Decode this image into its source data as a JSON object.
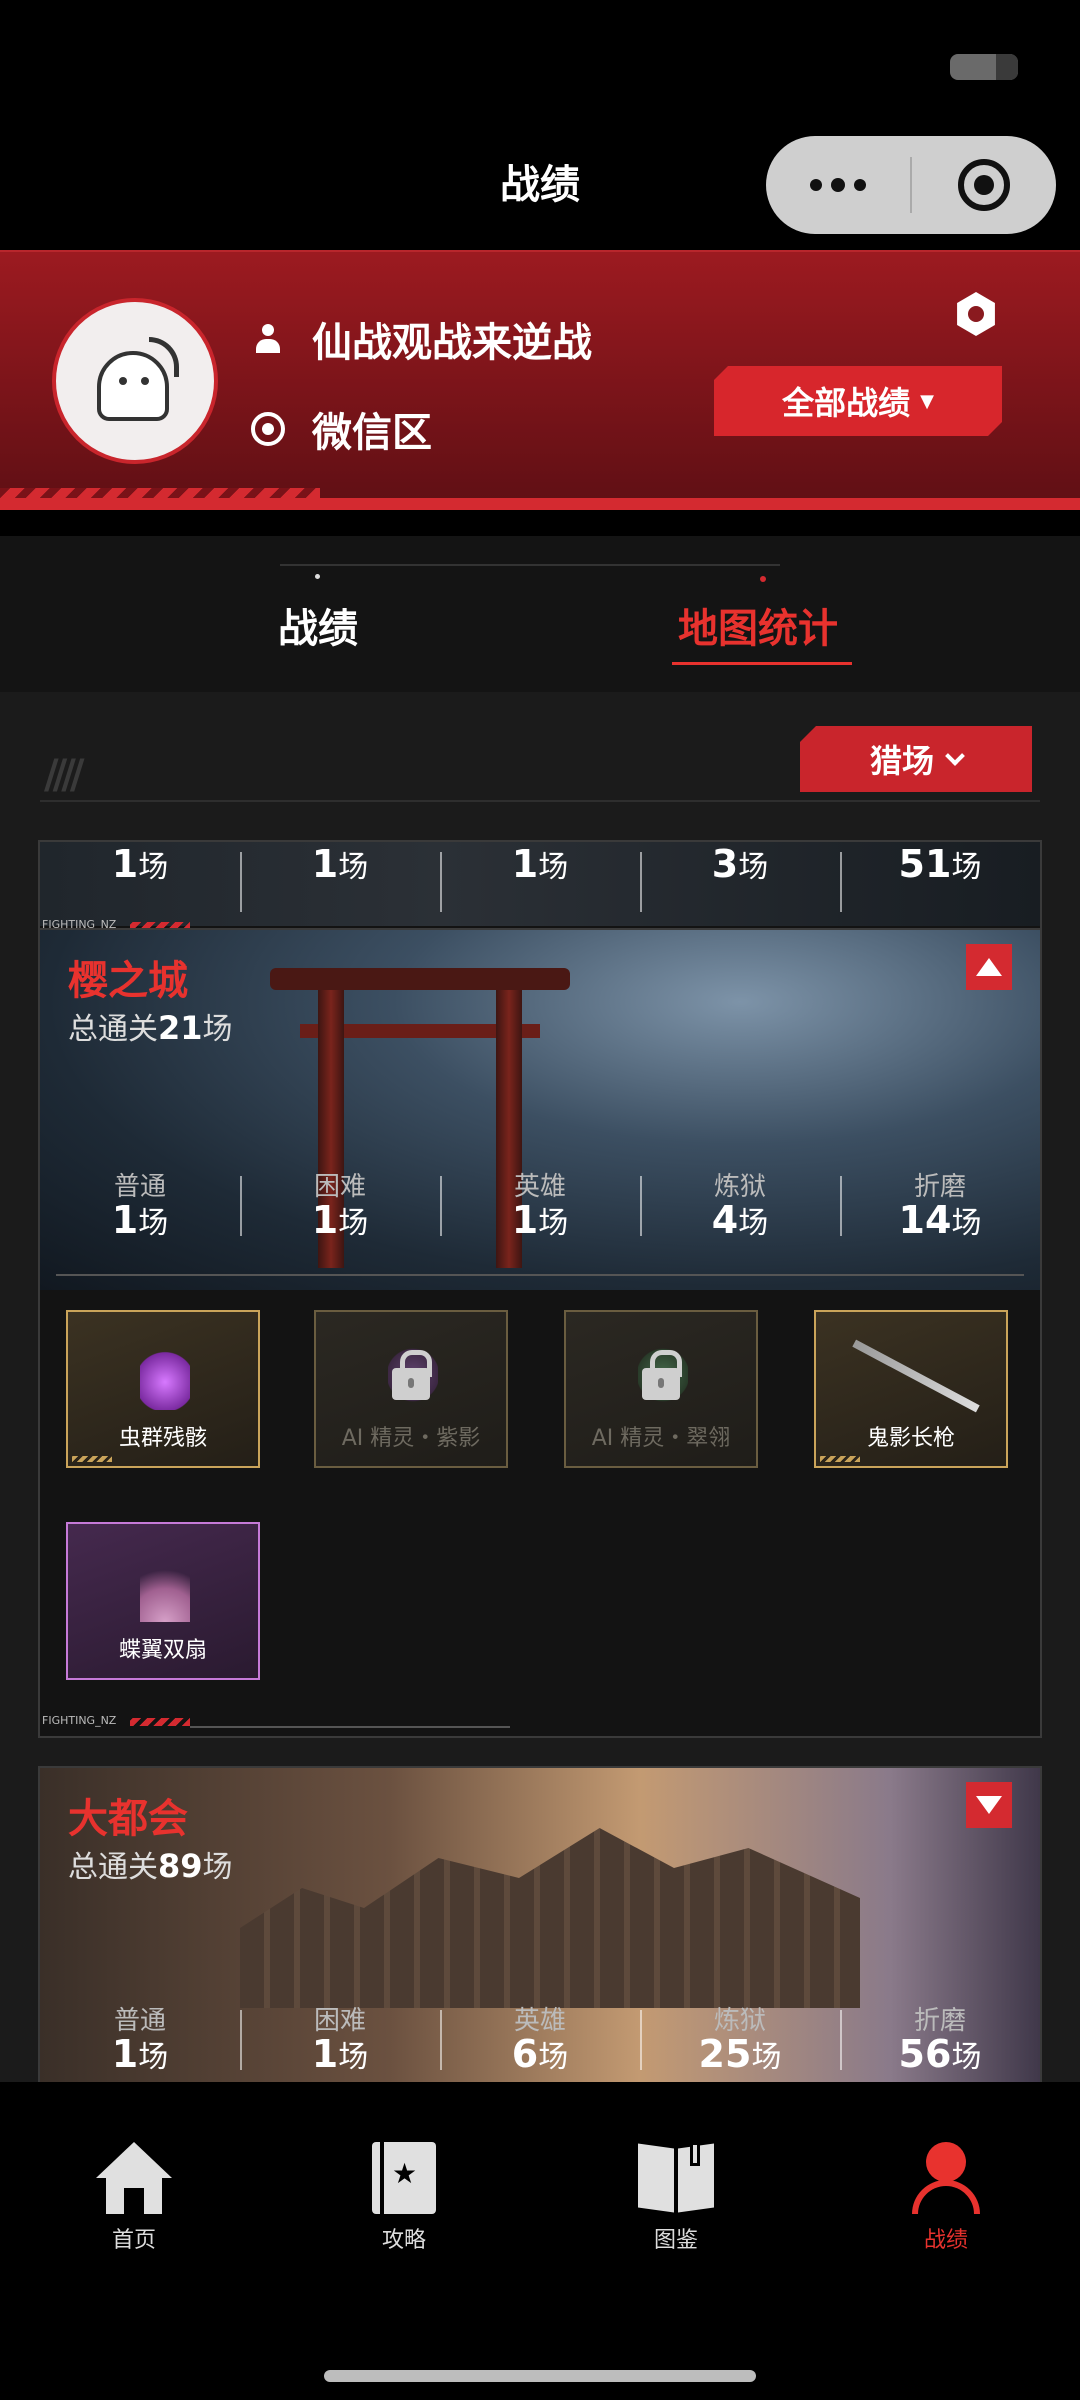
{
  "app": {
    "title": "战绩"
  },
  "profile": {
    "nickname": "仙战观战来逆战",
    "region": "微信区",
    "all_records_label": "全部战绩"
  },
  "tabs": [
    {
      "label": "战绩",
      "active": false
    },
    {
      "label": "地图统计",
      "active": true
    }
  ],
  "filter": {
    "mode_label": "猎场"
  },
  "stat_labels": [
    "普通",
    "困难",
    "英雄",
    "炼狱",
    "折磨"
  ],
  "maps": [
    {
      "name": "",
      "total_label": "",
      "values": [
        "1",
        "1",
        "1",
        "3",
        "51"
      ]
    },
    {
      "name": "樱之城",
      "total_prefix": "总通关",
      "total_count": "21",
      "total_suffix": "场",
      "expanded": true,
      "values": [
        "1",
        "1",
        "1",
        "4",
        "14"
      ],
      "unit": "场",
      "items": [
        {
          "name": "虫群残骸",
          "locked": false,
          "rarity": "gold",
          "icon": "claw-icon"
        },
        {
          "name": "AI 精灵・紫影",
          "locked": true,
          "rarity": "gold",
          "icon": "ghost-icon"
        },
        {
          "name": "AI 精灵・翠翎",
          "locked": true,
          "rarity": "gold",
          "icon": "ghost-icon"
        },
        {
          "name": "鬼影长枪",
          "locked": false,
          "rarity": "gold",
          "icon": "spear-icon"
        },
        {
          "name": "蝶翼双扇",
          "locked": false,
          "rarity": "purple",
          "icon": "fan-icon"
        }
      ]
    },
    {
      "name": "大都会",
      "total_prefix": "总通关",
      "total_count": "89",
      "total_suffix": "场",
      "expanded": false,
      "values": [
        "1",
        "1",
        "6",
        "25",
        "56"
      ],
      "unit": "场"
    }
  ],
  "card_footer_text": "FIGHTING_NZ",
  "nav": [
    {
      "label": "首页",
      "icon": "home-icon",
      "active": false
    },
    {
      "label": "攻略",
      "icon": "guide-icon",
      "active": false
    },
    {
      "label": "图鉴",
      "icon": "book-icon",
      "active": false
    },
    {
      "label": "战绩",
      "icon": "profile-icon",
      "active": true
    }
  ],
  "colors": {
    "accent": "#e8322e",
    "header_red": "#9c1a20",
    "gold_border": "#caa45a",
    "purple_border": "#c67ad8"
  }
}
